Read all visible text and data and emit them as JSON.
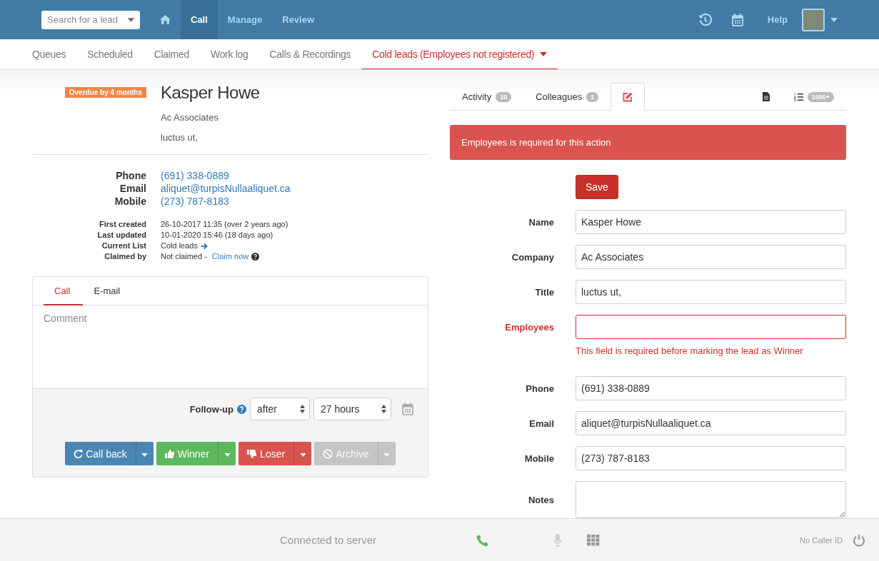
{
  "topbar": {
    "search": {
      "placeholder": "Search for a lead"
    },
    "nav": [
      {
        "kind": "home",
        "selected": false
      },
      {
        "kind": "text",
        "label": "Call",
        "selected": true
      },
      {
        "kind": "text",
        "label": "Manage",
        "selected": false
      },
      {
        "kind": "text",
        "label": "Review",
        "selected": false
      }
    ],
    "help": "Help"
  },
  "subnav": [
    {
      "label": "Queues",
      "selected": false
    },
    {
      "label": "Scheduled",
      "selected": false
    },
    {
      "label": "Claimed",
      "selected": false
    },
    {
      "label": "Work log",
      "selected": false
    },
    {
      "label": "Calls & Recordings",
      "selected": false
    },
    {
      "label": "Cold leads (Employees not registered)",
      "selected": true
    }
  ],
  "lead": {
    "badge": "Overdue by 4 months",
    "name": "Kasper Howe",
    "company": "Ac Associates",
    "title": "luctus ut,"
  },
  "contacts": [
    {
      "label": "Phone",
      "value": "(691) 338-0889"
    },
    {
      "label": "Email",
      "value": "aliquet@turpisNullaaliquet.ca"
    },
    {
      "label": "Mobile",
      "value": "(273) 787-8183"
    }
  ],
  "meta": [
    {
      "label": "First created",
      "value": "26-10-2017 11:35 (over 2 years ago)"
    },
    {
      "label": "Last updated",
      "value": "10-01-2020 15:46 (18 days ago)"
    },
    {
      "label": "Current List",
      "value": "Cold leads",
      "kind": "list"
    },
    {
      "label": "Claimed by",
      "value": "Not claimed - ",
      "link": "Claim now",
      "kind": "claim"
    }
  ],
  "composer": {
    "tabs": [
      {
        "label": "Call",
        "selected": true
      },
      {
        "label": "E-mail",
        "selected": false
      }
    ],
    "placeholder": "Comment",
    "followup_label": "Follow-up",
    "selects": [
      "after",
      "27 hours"
    ],
    "actions": [
      {
        "kind": "callback",
        "label": "Call back",
        "disabled": false
      },
      {
        "kind": "winner",
        "label": "Winner",
        "disabled": false
      },
      {
        "kind": "loser",
        "label": "Loser",
        "disabled": false
      },
      {
        "kind": "archive",
        "label": "Archive",
        "disabled": true
      }
    ]
  },
  "panel_tabs": [
    {
      "kind": "text",
      "label": "Activity",
      "count": "10",
      "selected": false
    },
    {
      "kind": "text",
      "label": "Colleagues",
      "count": "1",
      "selected": false
    },
    {
      "kind": "edit",
      "selected": true
    },
    {
      "kind": "document",
      "selected": false
    },
    {
      "kind": "list",
      "count": "1000+",
      "selected": false
    }
  ],
  "alert": "Employees is required for this action",
  "save": "Save",
  "fields": [
    {
      "kind": "input",
      "label": "Name",
      "value": "Kasper Howe",
      "invalid": false
    },
    {
      "kind": "input",
      "label": "Company",
      "value": "Ac Associates",
      "invalid": false
    },
    {
      "kind": "input",
      "label": "Title",
      "value": "luctus ut,",
      "invalid": false
    },
    {
      "kind": "input",
      "label": "Employees",
      "invalid": true,
      "error": "This field is required before marking the lead as Winner"
    },
    {
      "kind": "input",
      "label": "Phone",
      "value": "(691) 338-0889",
      "invalid": false
    },
    {
      "kind": "input",
      "label": "Email",
      "value": "aliquet@turpisNullaaliquet.ca",
      "invalid": false
    },
    {
      "kind": "input",
      "label": "Mobile",
      "value": "(273) 787-8183",
      "invalid": false
    },
    {
      "kind": "textarea",
      "label": "Notes",
      "invalid": false
    }
  ],
  "status_bar": {
    "status": "Connected to server",
    "caller_id": "No Caller ID"
  }
}
